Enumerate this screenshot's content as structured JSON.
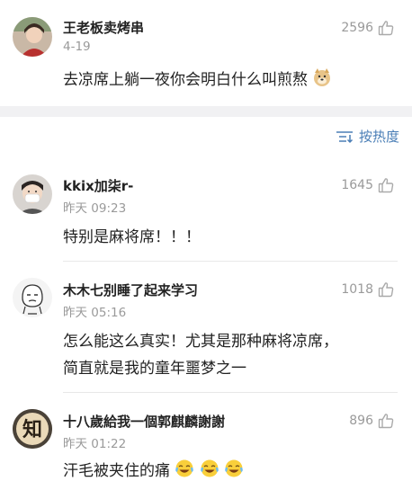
{
  "comments": [
    {
      "author": "王老板卖烤串",
      "time": "4-19",
      "likes": "2596",
      "text": "去凉席上躺一夜你会明白什么叫煎熬",
      "avatar_icon": "avatar-photo-icon",
      "emojis": [
        "doge-emoji"
      ]
    },
    {
      "author": "kkix加柒r-",
      "time": "昨天 09:23",
      "likes": "1645",
      "text": "特别是麻将席！！！",
      "avatar_icon": "avatar-photo-icon"
    },
    {
      "author": "木木七别睡了起来学习",
      "time": "昨天 05:16",
      "likes": "1018",
      "text_lines": [
        "怎么能这么真实！尤其是那种麻将凉席，",
        "简直就是我的童年噩梦之一"
      ],
      "avatar_icon": "avatar-cartoon-icon"
    },
    {
      "author": "十八歲給我一個郭麒麟謝謝",
      "time": "昨天 01:22",
      "likes": "896",
      "text": "汗毛被夹住的痛",
      "avatar_icon": "avatar-zhi-icon",
      "avatar_char": "知",
      "emojis": [
        "laugh-cry-emoji",
        "laugh-cry-emoji",
        "laugh-cry-emoji"
      ]
    }
  ],
  "sort": {
    "label": "按热度",
    "icon": "sort-icon"
  },
  "colors": {
    "link": "#4a7eb6",
    "meta": "#9a9a9a",
    "text": "#222222",
    "gap": "#f1f1f3"
  }
}
